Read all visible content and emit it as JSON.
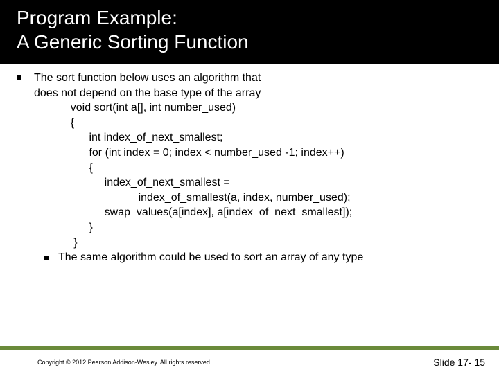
{
  "title": {
    "line1": "Program Example:",
    "line2": "A Generic Sorting Function"
  },
  "bullet1": {
    "line1": "The sort function below uses an algorithm that",
    "line2": "does not depend on the base type of the array"
  },
  "code": "    void sort(int a[], int number_used)\n    {\n          int index_of_next_smallest;\n          for (int index = 0; index < number_used -1; index++)\n          {\n               index_of_next_smallest = \n                          index_of_smallest(a, index, number_used);\n               swap_values(a[index], a[index_of_next_smallest]);\n          }\n     }",
  "bullet2": "The same algorithm could be used to sort an array of any type",
  "footer": {
    "copyright": "Copyright © 2012 Pearson Addison-Wesley.  All rights reserved.",
    "slide": "Slide 17- 15"
  }
}
